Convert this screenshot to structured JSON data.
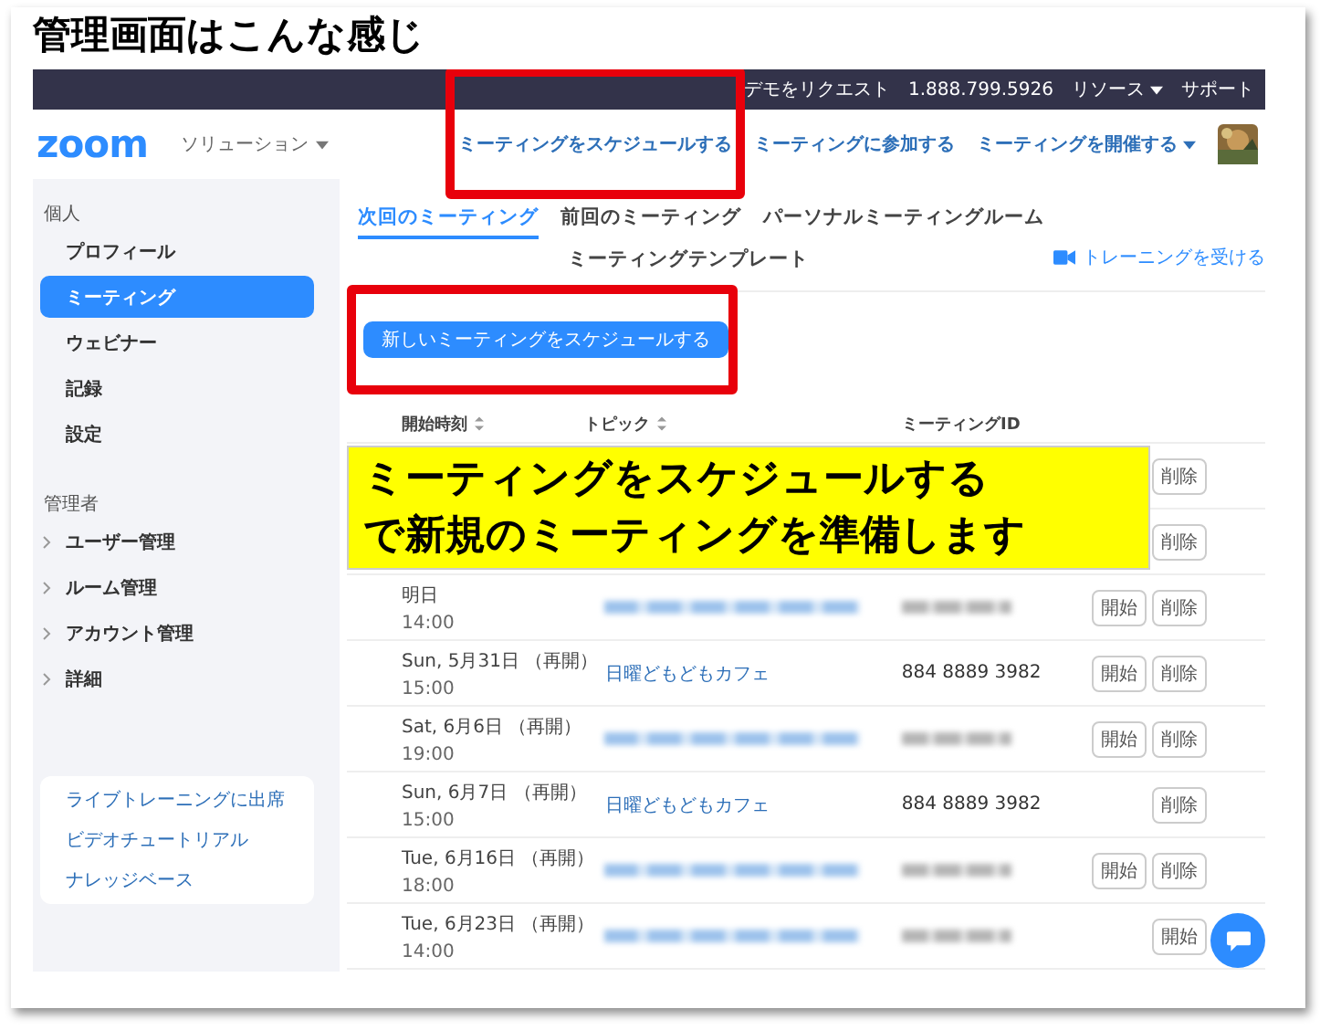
{
  "heading": "管理画面はこんな感じ",
  "top_bar": {
    "links": [
      {
        "label": "デモをリクエスト",
        "dropdown": false
      },
      {
        "label": "1.888.799.5926",
        "dropdown": false
      },
      {
        "label": "リソース",
        "dropdown": true
      },
      {
        "label": "サポート",
        "dropdown": false
      }
    ]
  },
  "nav": {
    "logo": "zoom",
    "solutions": {
      "label": "ソリューション",
      "dropdown": true
    },
    "links": [
      {
        "label": "ミーティングをスケジュールする",
        "dropdown": false,
        "highlighted": true
      },
      {
        "label": "ミーティングに参加する",
        "dropdown": false,
        "highlighted": false
      },
      {
        "label": "ミーティングを開催する",
        "dropdown": true,
        "highlighted": false
      }
    ]
  },
  "sidebar": {
    "sections": [
      {
        "title": "個人",
        "items": [
          {
            "label": "プロフィール",
            "selected": false,
            "expandable": false
          },
          {
            "label": "ミーティング",
            "selected": true,
            "expandable": false
          },
          {
            "label": "ウェビナー",
            "selected": false,
            "expandable": false
          },
          {
            "label": "記録",
            "selected": false,
            "expandable": false
          },
          {
            "label": "設定",
            "selected": false,
            "expandable": false
          }
        ]
      },
      {
        "title": "管理者",
        "items": [
          {
            "label": "ユーザー管理",
            "selected": false,
            "expandable": true
          },
          {
            "label": "ルーム管理",
            "selected": false,
            "expandable": true
          },
          {
            "label": "アカウント管理",
            "selected": false,
            "expandable": true
          },
          {
            "label": "詳細",
            "selected": false,
            "expandable": true
          }
        ]
      }
    ],
    "help_links": [
      "ライブトレーニングに出席",
      "ビデオチュートリアル",
      "ナレッジベース"
    ]
  },
  "tabs": [
    {
      "label": "次回のミーティング",
      "selected": true
    },
    {
      "label": "前回のミーティング",
      "selected": false
    },
    {
      "label": "パーソナルミーティングルーム",
      "selected": false
    },
    {
      "label": "ミーティングテンプレート",
      "selected": false
    }
  ],
  "training_link": "トレーニングを受ける",
  "new_meeting_button": {
    "label": "新しいミーティングをスケジュールする",
    "highlighted": true
  },
  "table": {
    "columns": [
      {
        "label": "開始時刻",
        "sortable": true
      },
      {
        "label": "トピック",
        "sortable": true
      },
      {
        "label": "ミーティングID",
        "sortable": false
      }
    ],
    "rows": [
      {
        "covered": true,
        "actions": [
          "削除"
        ]
      },
      {
        "covered": true,
        "actions": [
          "削除"
        ]
      },
      {
        "covered": false,
        "date": "明日",
        "time": "14:00",
        "topic": {
          "kind": "blurred"
        },
        "meeting_id": {
          "kind": "blurred"
        },
        "actions": [
          "開始",
          "削除"
        ]
      },
      {
        "covered": false,
        "date": "Sun, 5月31日 （再開）",
        "time": "15:00",
        "topic": {
          "kind": "text",
          "text": "日曜どもどもカフェ"
        },
        "meeting_id": {
          "kind": "text",
          "text": "884 8889 3982"
        },
        "actions": [
          "開始",
          "削除"
        ]
      },
      {
        "covered": false,
        "date": "Sat, 6月6日 （再開）",
        "time": "19:00",
        "topic": {
          "kind": "blurred"
        },
        "meeting_id": {
          "kind": "blurred"
        },
        "actions": [
          "開始",
          "削除"
        ]
      },
      {
        "covered": false,
        "date": "Sun, 6月7日 （再開）",
        "time": "15:00",
        "topic": {
          "kind": "text",
          "text": "日曜どもどもカフェ"
        },
        "meeting_id": {
          "kind": "text",
          "text": "884 8889 3982"
        },
        "actions": [
          "削除"
        ]
      },
      {
        "covered": false,
        "date": "Tue, 6月16日 （再開）",
        "time": "18:00",
        "topic": {
          "kind": "blurred"
        },
        "meeting_id": {
          "kind": "blurred"
        },
        "actions": [
          "開始",
          "削除"
        ]
      },
      {
        "covered": false,
        "date": "Tue, 6月23日 （再開）",
        "time": "14:00",
        "topic": {
          "kind": "blurred"
        },
        "meeting_id": {
          "kind": "blurred"
        },
        "actions": [
          "開始"
        ]
      }
    ]
  },
  "callout": {
    "lines": [
      "ミーティングをスケジュールする",
      "で新規のミーティングを準備します"
    ]
  },
  "chat_button": true
}
